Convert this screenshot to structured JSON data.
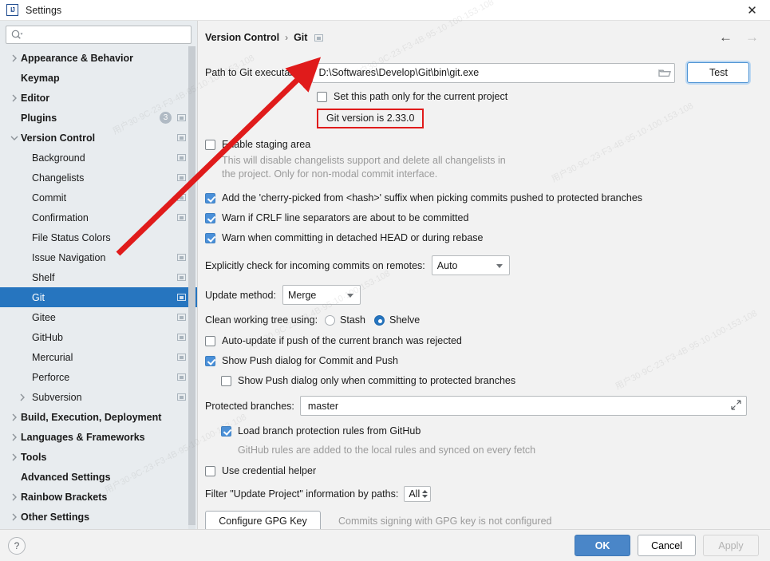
{
  "window": {
    "title": "Settings",
    "logo_icon": "intellij-idea-logo",
    "close_icon": "close-icon"
  },
  "sidebar": {
    "search": {
      "placeholder": "",
      "value": "",
      "icon": "search-icon"
    },
    "items": [
      {
        "label": "Appearance & Behavior",
        "level": 0,
        "bold": true,
        "arrow": "right",
        "badge": "",
        "mini": false
      },
      {
        "label": "Keymap",
        "level": 0,
        "bold": true,
        "arrow": "",
        "badge": "",
        "mini": false
      },
      {
        "label": "Editor",
        "level": 0,
        "bold": true,
        "arrow": "right",
        "badge": "",
        "mini": false
      },
      {
        "label": "Plugins",
        "level": 0,
        "bold": true,
        "arrow": "",
        "badge": "3",
        "mini": true
      },
      {
        "label": "Version Control",
        "level": 0,
        "bold": true,
        "arrow": "down",
        "badge": "",
        "mini": true
      },
      {
        "label": "Background",
        "level": 1,
        "bold": false,
        "arrow": "",
        "badge": "",
        "mini": true
      },
      {
        "label": "Changelists",
        "level": 1,
        "bold": false,
        "arrow": "",
        "badge": "",
        "mini": true
      },
      {
        "label": "Commit",
        "level": 1,
        "bold": false,
        "arrow": "",
        "badge": "",
        "mini": true
      },
      {
        "label": "Confirmation",
        "level": 1,
        "bold": false,
        "arrow": "",
        "badge": "",
        "mini": true
      },
      {
        "label": "File Status Colors",
        "level": 1,
        "bold": false,
        "arrow": "",
        "badge": "",
        "mini": false
      },
      {
        "label": "Issue Navigation",
        "level": 1,
        "bold": false,
        "arrow": "",
        "badge": "",
        "mini": true
      },
      {
        "label": "Shelf",
        "level": 1,
        "bold": false,
        "arrow": "",
        "badge": "",
        "mini": true
      },
      {
        "label": "Git",
        "level": 1,
        "bold": false,
        "arrow": "",
        "badge": "",
        "mini": true,
        "selected": true
      },
      {
        "label": "Gitee",
        "level": 1,
        "bold": false,
        "arrow": "",
        "badge": "",
        "mini": true
      },
      {
        "label": "GitHub",
        "level": 1,
        "bold": false,
        "arrow": "",
        "badge": "",
        "mini": true
      },
      {
        "label": "Mercurial",
        "level": 1,
        "bold": false,
        "arrow": "",
        "badge": "",
        "mini": true
      },
      {
        "label": "Perforce",
        "level": 1,
        "bold": false,
        "arrow": "",
        "badge": "",
        "mini": true
      },
      {
        "label": "Subversion",
        "level": 1,
        "bold": false,
        "arrow": "right",
        "badge": "",
        "mini": true
      },
      {
        "label": "Build, Execution, Deployment",
        "level": 0,
        "bold": true,
        "arrow": "right",
        "badge": "",
        "mini": false
      },
      {
        "label": "Languages & Frameworks",
        "level": 0,
        "bold": true,
        "arrow": "right",
        "badge": "",
        "mini": false
      },
      {
        "label": "Tools",
        "level": 0,
        "bold": true,
        "arrow": "right",
        "badge": "",
        "mini": false
      },
      {
        "label": "Advanced Settings",
        "level": 0,
        "bold": true,
        "arrow": "",
        "badge": "",
        "mini": false
      },
      {
        "label": "Rainbow Brackets",
        "level": 0,
        "bold": true,
        "arrow": "right",
        "badge": "",
        "mini": false
      },
      {
        "label": "Other Settings",
        "level": 0,
        "bold": true,
        "arrow": "right",
        "badge": "",
        "mini": false
      }
    ]
  },
  "content": {
    "breadcrumb": {
      "parent": "Version Control",
      "separator": "›",
      "current": "Git",
      "trailing_icon": "restore-defaults-icon"
    },
    "nav": {
      "back_icon": "arrow-left-icon",
      "forward_icon": "arrow-right-icon"
    },
    "path_label": "Path to Git executable:",
    "path_value": "D:\\Softwares\\Develop\\Git\\bin\\git.exe",
    "browse_icon": "folder-icon",
    "test_button": "Test",
    "set_path_only_label": "Set this path only for the current project",
    "set_path_only_checked": false,
    "git_version": "Git version is 2.33.0",
    "git_version_highlight_color": "#e01b1b",
    "enable_staging_label": "Enable staging area",
    "enable_staging_checked": false,
    "staging_hint_line1": "This will disable changelists support and delete all changelists in",
    "staging_hint_line2": "the project. Only for non-modal commit interface.",
    "cherry_pick_label": "Add the 'cherry-picked from <hash>' suffix when picking commits pushed to protected branches",
    "cherry_pick_checked": true,
    "crlf_label": "Warn if CRLF line separators are about to be committed",
    "crlf_checked": true,
    "detached_head_label": "Warn when committing in detached HEAD or during rebase",
    "detached_head_checked": true,
    "incoming_label": "Explicitly check for incoming commits on remotes:",
    "incoming_value": "Auto",
    "incoming_options": [
      "Auto"
    ],
    "update_method_label": "Update method:",
    "update_method_value": "Merge",
    "update_method_options": [
      "Merge"
    ],
    "clean_tree_label": "Clean working tree using:",
    "clean_tree_option_stash": "Stash",
    "clean_tree_option_shelve": "Shelve",
    "clean_tree_selected": "Shelve",
    "auto_update_label": "Auto-update if push of the current branch was rejected",
    "auto_update_checked": false,
    "show_push_label": "Show Push dialog for Commit and Push",
    "show_push_checked": true,
    "show_push_protected_label": "Show Push dialog only when committing to protected branches",
    "show_push_protected_checked": false,
    "protected_branches_label": "Protected branches:",
    "protected_branches_value": "master",
    "expand_icon": "expand-icon",
    "load_rules_label": "Load branch protection rules from GitHub",
    "load_rules_checked": true,
    "load_rules_hint": "GitHub rules are added to the local rules and synced on every fetch",
    "credential_helper_label": "Use credential helper",
    "credential_helper_checked": false,
    "filter_paths_label": "Filter \"Update Project\" information by paths:",
    "filter_paths_value": "All",
    "gpg_button": "Configure GPG Key",
    "gpg_hint": "Commits signing with GPG key is not configured"
  },
  "footer": {
    "help_icon": "help-icon",
    "ok": "OK",
    "cancel": "Cancel",
    "apply": "Apply",
    "ok_color": "#4a86c8"
  },
  "annotation": {
    "arrow_color": "#e01b1b"
  },
  "watermarks": [
    "用户30·9C·23·F3·4B·95·10·100·153·108",
    "用户30·9C·23·F3·4B·95·10·100·153·108",
    "用户30·9C·23·F3·4B·95·10·100·153·108",
    "用户30·9C·23·F3·4B·95·10·100·153·108",
    "用户30·9C·23·F3·4B·95·10·100·153·108",
    "用户30·9C·23·F3·4B·95·10·100·153·108"
  ]
}
